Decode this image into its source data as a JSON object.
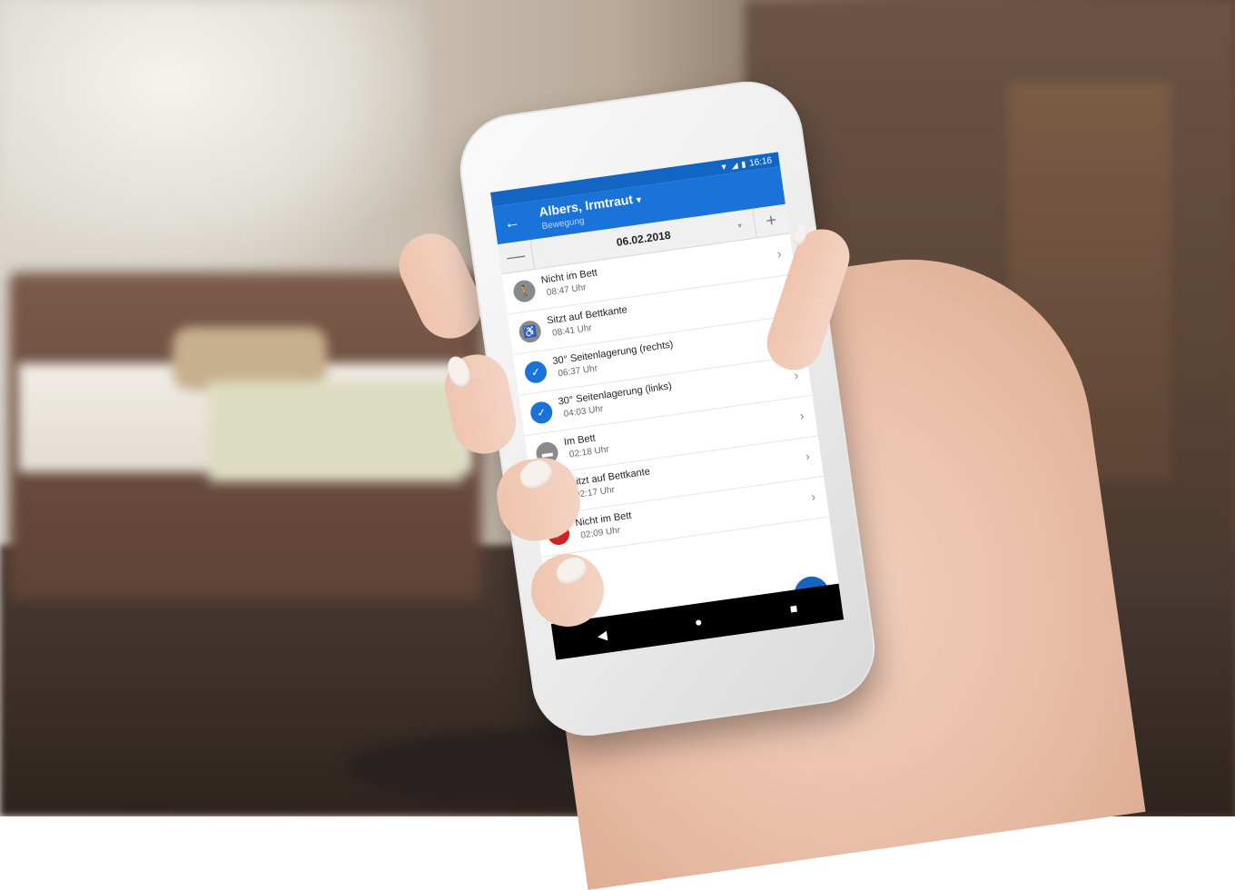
{
  "colors": {
    "app_bar": "#1a73d9",
    "status_bar": "#1265c3",
    "fab": "#1565c0",
    "icon_grey": "#8a8a8a",
    "icon_blue": "#1a73d9",
    "icon_yellow": "#e8c21a",
    "icon_red": "#d32020"
  },
  "status_bar": {
    "time": "16:16",
    "icons": [
      "wifi-icon",
      "signal-icon",
      "battery-icon"
    ]
  },
  "app_bar": {
    "back_icon": "arrow-left-icon",
    "title": "Albers, Irmtraut",
    "title_caret": "▾",
    "subtitle": "Bewegung"
  },
  "date_bar": {
    "minus_label": "—",
    "date": "06.02.2018",
    "dropdown_caret": "▾",
    "plus_label": "+"
  },
  "entries": [
    {
      "label": "Nicht im Bett",
      "time": "08:47 Uhr",
      "icon": "walking-person-icon",
      "status": "grey"
    },
    {
      "label": "Sitzt auf Bettkante",
      "time": "08:41 Uhr",
      "icon": "sitting-person-icon",
      "status": "grey"
    },
    {
      "label": "30° Seitenlagerung (rechts)",
      "time": "06:37 Uhr",
      "icon": "check-icon",
      "status": "blue"
    },
    {
      "label": "30° Seitenlagerung (links)",
      "time": "04:03 Uhr",
      "icon": "check-icon",
      "status": "blue"
    },
    {
      "label": "Im Bett",
      "time": "02:18 Uhr",
      "icon": "bed-icon",
      "status": "grey"
    },
    {
      "label": "Sitzt auf Bettkante",
      "time": "02:17 Uhr",
      "icon": "sitting-person-icon",
      "status": "yellow"
    },
    {
      "label": "Nicht im Bett",
      "time": "02:09 Uhr",
      "icon": "walking-person-icon",
      "status": "red"
    }
  ],
  "fab": {
    "label": "+",
    "icon": "add-icon"
  },
  "nav_bar": {
    "back": "◀",
    "home": "●",
    "recents": "■"
  }
}
